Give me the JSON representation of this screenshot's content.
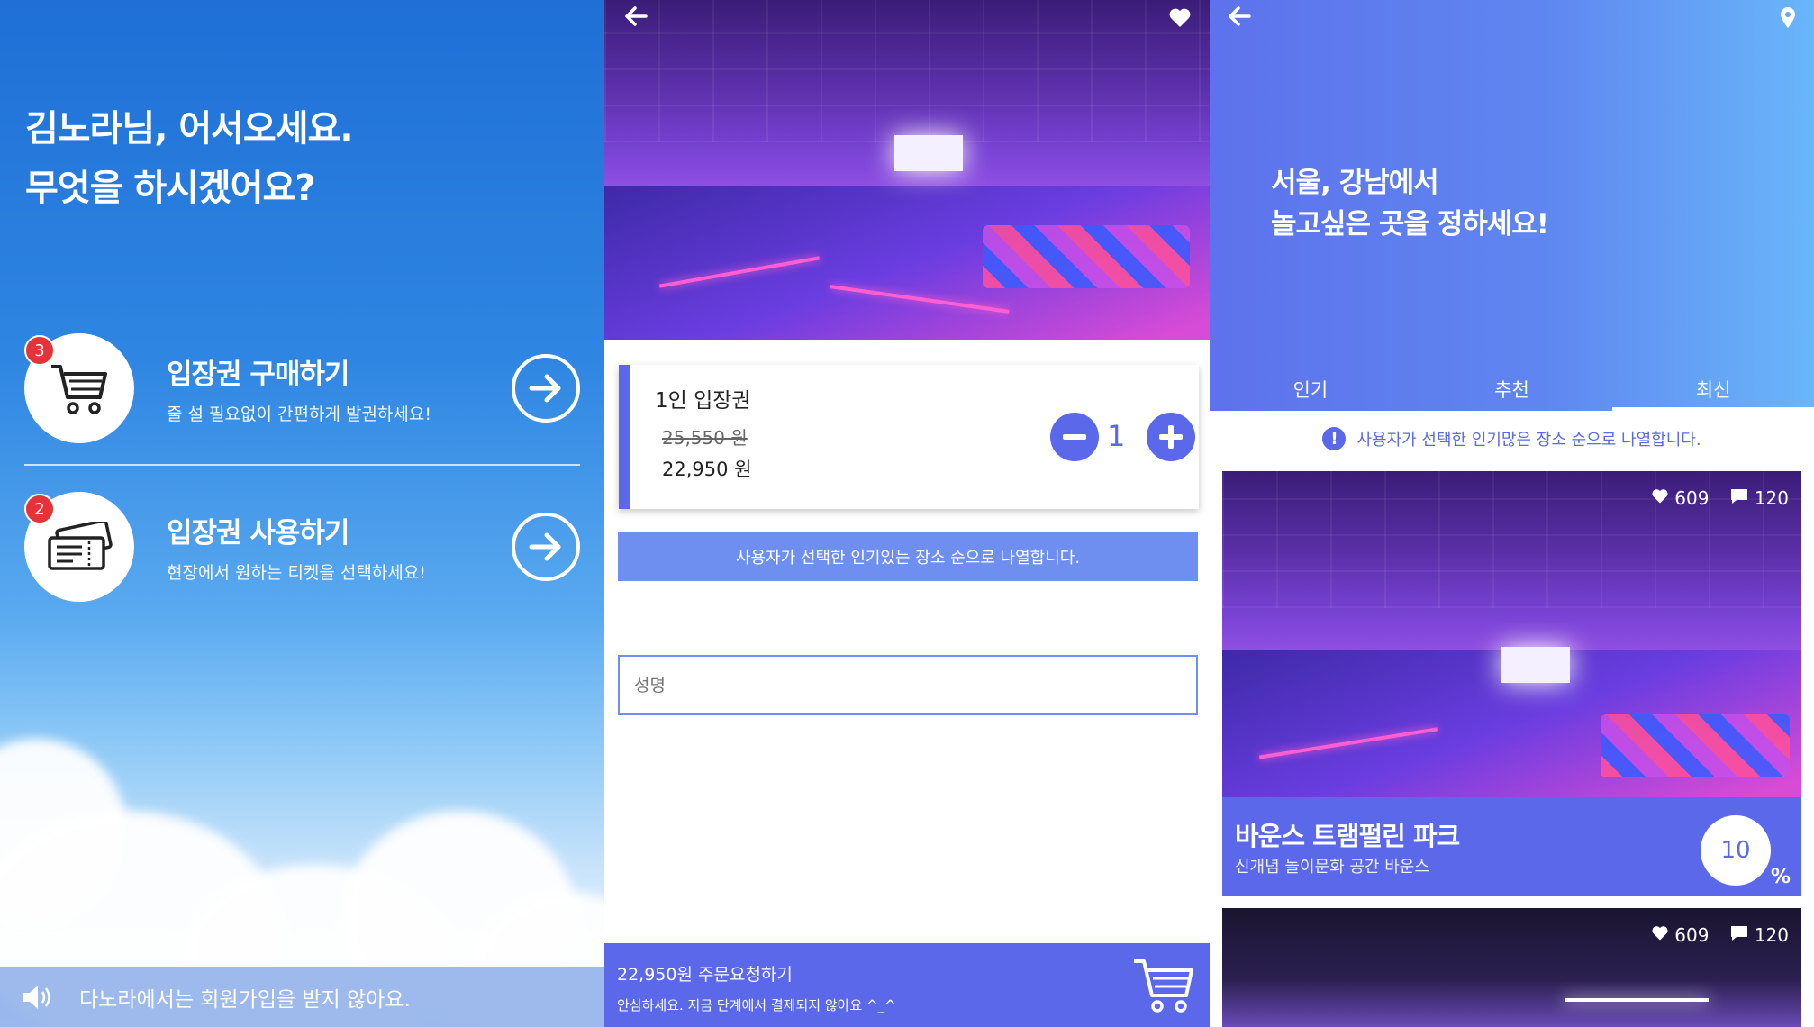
{
  "panel1": {
    "greeting": [
      "김노라님, 어서오세요.",
      "무엇을 하시겠어요?"
    ],
    "menu": [
      {
        "badge": "3",
        "title": "입장권 구매하기",
        "subtitle": "줄 설 필요없이 간편하게 발권하세요!",
        "icon": "cart-icon"
      },
      {
        "badge": "2",
        "title": "입장권 사용하기",
        "subtitle": "현장에서 원하는 티켓을 선택하세요!",
        "icon": "ticket-icon"
      }
    ],
    "notice": "다노라에서는 회원가입을 받지 않아요."
  },
  "panel2": {
    "ticket": {
      "name": "1인 입장권",
      "original_price": "25,550 원",
      "price": "22,950 원",
      "quantity": "1"
    },
    "info": "사용자가 선택한 인기있는 장소 순으로 나열합니다.",
    "name_placeholder": "성명",
    "order": {
      "main": "22,950원 주문요청하기",
      "sub": "안심하세요. 지금 단계에서 결제되지 않아요 ^_^"
    }
  },
  "panel3": {
    "title": [
      "서울, 강남에서",
      "놀고싶은 곳을 정하세요!"
    ],
    "tabs": [
      "인기",
      "추천",
      "최신"
    ],
    "active_tab": "최신",
    "notice": "사용자가 선택한 인기많은 장소 순으로 나열합니다.",
    "places": [
      {
        "likes": "609",
        "comments": "120",
        "name": "바운스 트램펄린 파크",
        "desc": "신개념 놀이문화 공간 바운스",
        "discount": "10",
        "pct": "%"
      },
      {
        "likes": "609",
        "comments": "120"
      }
    ]
  },
  "colors": {
    "accent": "#5b68ea",
    "info_bar": "#6e8ff0",
    "badge": "#e5333a"
  }
}
